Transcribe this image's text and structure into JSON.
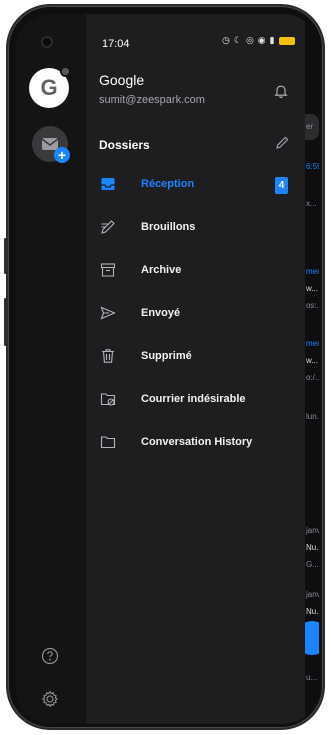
{
  "status_bar": {
    "time": "17:04",
    "icons": [
      "alarm-icon",
      "do-not-disturb-icon",
      "hotspot-icon",
      "wifi-icon",
      "signal-icon",
      "battery-icon"
    ]
  },
  "account": {
    "avatar_letter": "G",
    "name": "Google",
    "email": "sumit@zeespark.com"
  },
  "drawer": {
    "section_title": "Dossiers",
    "folders": [
      {
        "label": "Réception",
        "count": "4",
        "active": true,
        "icon": "inbox-icon"
      },
      {
        "label": "Brouillons",
        "icon": "draft-icon"
      },
      {
        "label": "Archive",
        "icon": "archive-icon"
      },
      {
        "label": "Envoyé",
        "icon": "send-icon"
      },
      {
        "label": "Supprimé",
        "icon": "trash-icon"
      },
      {
        "label": "Courrier indésirable",
        "icon": "junk-folder-icon"
      },
      {
        "label": "Conversation History",
        "icon": "folder-icon"
      }
    ]
  },
  "behind_list": {
    "search_fragment": "er",
    "time_fragment": "6:59",
    "snippets": [
      "x...",
      "mer.",
      "w...",
      "os:...",
      "mer.",
      "w...",
      "o:/...",
      "lun.",
      "janv.",
      "Nu...",
      "G...",
      "janv.",
      "Nu...",
      "u..."
    ]
  },
  "colors": {
    "accent": "#1a85ff",
    "drawer_bg": "#1e1e20",
    "rail_bg": "#141415"
  }
}
